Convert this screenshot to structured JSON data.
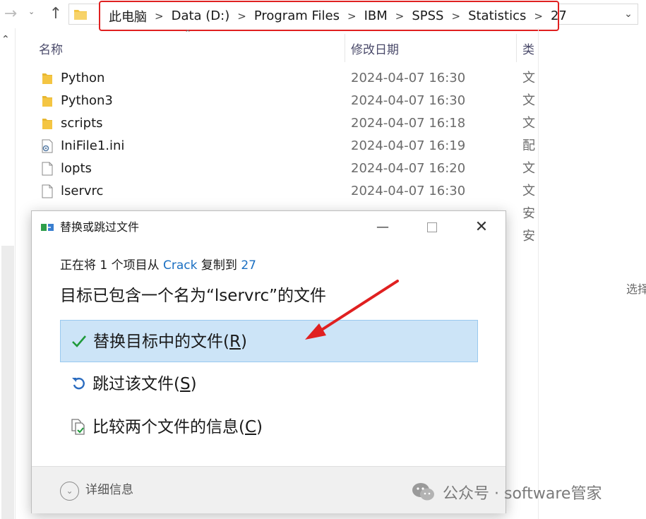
{
  "address_bar": {
    "crumbs": [
      "此电脑",
      "Data (D:)",
      "Program Files",
      "IBM",
      "SPSS",
      "Statistics",
      "27"
    ],
    "separator": ">"
  },
  "columns": {
    "name": "名称",
    "date": "修改日期",
    "type": "类"
  },
  "files": [
    {
      "name": "Python",
      "date": "2024-04-07 16:30",
      "type": "文",
      "icon": "folder-icon"
    },
    {
      "name": "Python3",
      "date": "2024-04-07 16:30",
      "type": "文",
      "icon": "folder-icon"
    },
    {
      "name": "scripts",
      "date": "2024-04-07 16:18",
      "type": "文",
      "icon": "folder-icon"
    },
    {
      "name": "IniFile1.ini",
      "date": "2024-04-07 16:19",
      "type": "配",
      "icon": "settings-file-icon"
    },
    {
      "name": "lopts",
      "date": "2024-04-07 16:20",
      "type": "文",
      "icon": "file-icon"
    },
    {
      "name": "lservrc",
      "date": "2024-04-07 16:30",
      "type": "文",
      "icon": "file-icon"
    }
  ],
  "hidden_rows_types": [
    "安",
    "安"
  ],
  "side_text": "选择",
  "dialog": {
    "title": "替换或跳过文件",
    "copy_prefix": "正在将 1 个项目从 ",
    "copy_source": "Crack",
    "copy_middle": " 复制到 ",
    "copy_dest": "27",
    "heading": "目标已包含一个名为“lservrc”的文件",
    "options": [
      {
        "label": "替换目标中的文件(",
        "key": "R",
        "suffix": ")",
        "icon": "checkmark-icon",
        "selected": true
      },
      {
        "label": "跳过该文件(",
        "key": "S",
        "suffix": ")",
        "icon": "skip-arrow-icon",
        "selected": false
      },
      {
        "label": "比较两个文件的信息(",
        "key": "C",
        "suffix": ")",
        "icon": "compare-files-icon",
        "selected": false
      }
    ],
    "details_label": "详细信息"
  },
  "watermark": {
    "text": "公众号 · software管家"
  },
  "colors": {
    "highlight_red": "#e02020",
    "selected_bg": "#cce4f7",
    "link_blue": "#1a6fc2",
    "folder_yellow": "#f4c542"
  }
}
